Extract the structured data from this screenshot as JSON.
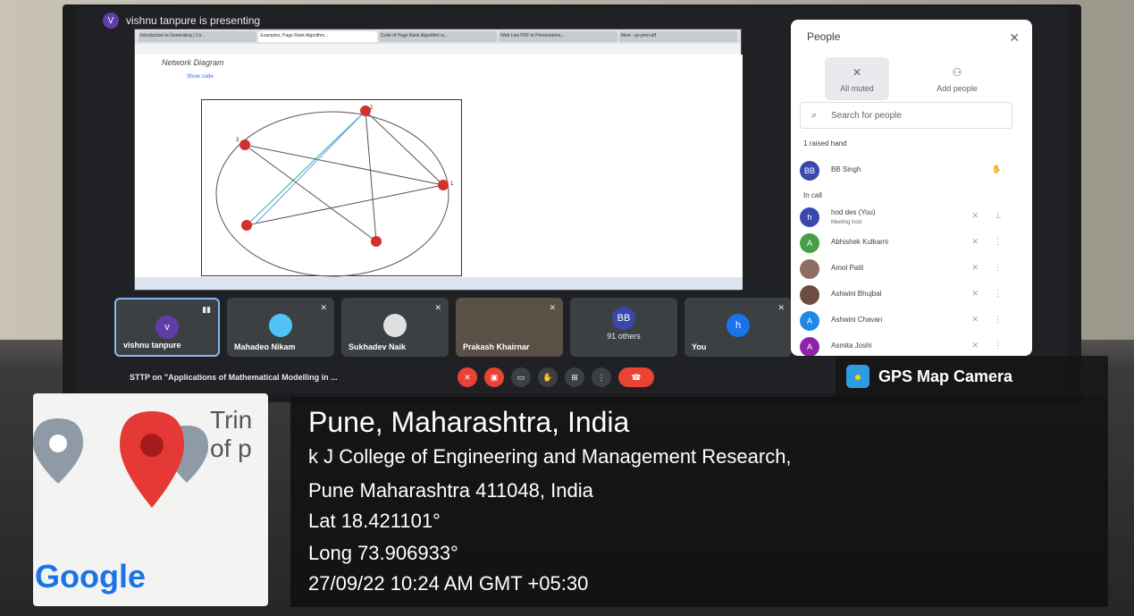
{
  "meet": {
    "presenter_initial": "V",
    "presenting_text": "vishnu tanpure is presenting",
    "meeting_title": "STTP on \"Applications of Mathematical Modelling in ...",
    "shared_notebook_title": "Network Diagram",
    "shared_link": "Show code"
  },
  "browser_tabs": [
    "Introduction to Generating | Co...",
    "Examples, Page Rank Algorithm...",
    "Code of Page Rank Algorithm w...",
    "Web Lies PDF to Presentation...",
    "Meet - gs-pmn-aff"
  ],
  "graph_nodes": [
    {
      "label": "2"
    },
    {
      "label": "3"
    },
    {
      "label": "1"
    },
    {
      "label": ""
    },
    {
      "label": ""
    }
  ],
  "tiles": [
    {
      "name": "vishnu tanpure",
      "initial": "v",
      "color": "#5f3ea8"
    },
    {
      "name": "Mahadeo Nikam"
    },
    {
      "name": "Sukhadev Naik"
    },
    {
      "name": "Prakash Khairnar"
    },
    {
      "others": "91 others",
      "initial": "BB"
    },
    {
      "name": "You",
      "initial": "h",
      "color": "#1a73e8"
    }
  ],
  "people": {
    "title": "People",
    "all_muted": "All muted",
    "add_people": "Add people",
    "search_placeholder": "Search for people",
    "raised_hand_label": "1 raised hand",
    "in_call_label": "In call",
    "raised": [
      {
        "initials": "BB",
        "name": "BB Singh",
        "color": "#3949ab"
      }
    ],
    "in_call": [
      {
        "initials": "h",
        "name": "hod des (You)",
        "sub": "Meeting host",
        "color": "#3949ab"
      },
      {
        "initials": "A",
        "name": "Abhishek Kulkarni",
        "color": "#43a047"
      },
      {
        "initials": "",
        "name": "Amol Patil",
        "color": "#8d6e63"
      },
      {
        "initials": "",
        "name": "Ashwini Bhujbal",
        "color": "#6d4c41"
      },
      {
        "initials": "A",
        "name": "Ashwini Chavan",
        "color": "#1e88e5"
      },
      {
        "initials": "A",
        "name": "Asmita Joshi",
        "color": "#8e24aa"
      }
    ]
  },
  "gps": {
    "app_name": "GPS Map Camera",
    "city": "Pune, Maharashtra, India",
    "address_line1": "k J College of Engineering and Management Research,",
    "address_line2": "Pune Maharashtra 411048, India",
    "lat": "Lat 18.421101°",
    "long": "Long 73.906933°",
    "datetime": "27/09/22 10:24 AM GMT +05:30"
  },
  "map": {
    "text_fragment_1": "Trin",
    "text_fragment_2": "of p",
    "logo": "Google"
  }
}
